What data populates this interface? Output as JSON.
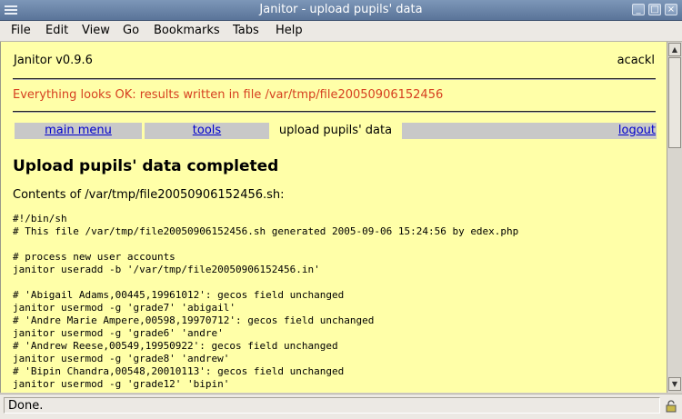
{
  "window": {
    "title": "Janitor - upload pupils' data"
  },
  "menubar": {
    "items": [
      "File",
      "Edit",
      "View",
      "Go",
      "Bookmarks",
      "Tabs",
      "Help"
    ]
  },
  "page": {
    "version": "Janitor v0.9.6",
    "user": "acackl",
    "status_message": "Everything looks OK: results written in file /var/tmp/file20050906152456",
    "nav": {
      "main_menu": "main menu",
      "tools": "tools",
      "current": "upload pupils' data",
      "logout": "logout"
    },
    "heading": "Upload pupils' data completed",
    "contents_label": "Contents of /var/tmp/file20050906152456.sh:",
    "script_lines": [
      "#!/bin/sh",
      "# This file /var/tmp/file20050906152456.sh generated 2005-09-06 15:24:56 by edex.php",
      "",
      "# process new user accounts",
      "janitor useradd -b '/var/tmp/file20050906152456.in'",
      "",
      "# 'Abigail Adams,00445,19961012': gecos field unchanged",
      "janitor usermod -g 'grade7' 'abigail'",
      "# 'Andre Marie Ampere,00598,19970712': gecos field unchanged",
      "janitor usermod -g 'grade6' 'andre'",
      "# 'Andrew Reese,00549,19950922': gecos field unchanged",
      "janitor usermod -g 'grade8' 'andrew'",
      "# 'Bipin Chandra,00548,20010113': gecos field unchanged",
      "janitor usermod -g 'grade12' 'bipin'"
    ]
  },
  "statusbar": {
    "text": "Done."
  },
  "colors": {
    "page_background": "#ffffa8",
    "status_message": "#d64020",
    "link": "#0000cc",
    "nav_background": "#c8c8c8"
  },
  "icons": {
    "window_menu": "window-menu-icon",
    "minimize": "minimize-icon",
    "maximize": "maximize-icon",
    "close": "close-icon",
    "security": "lock-icon"
  }
}
